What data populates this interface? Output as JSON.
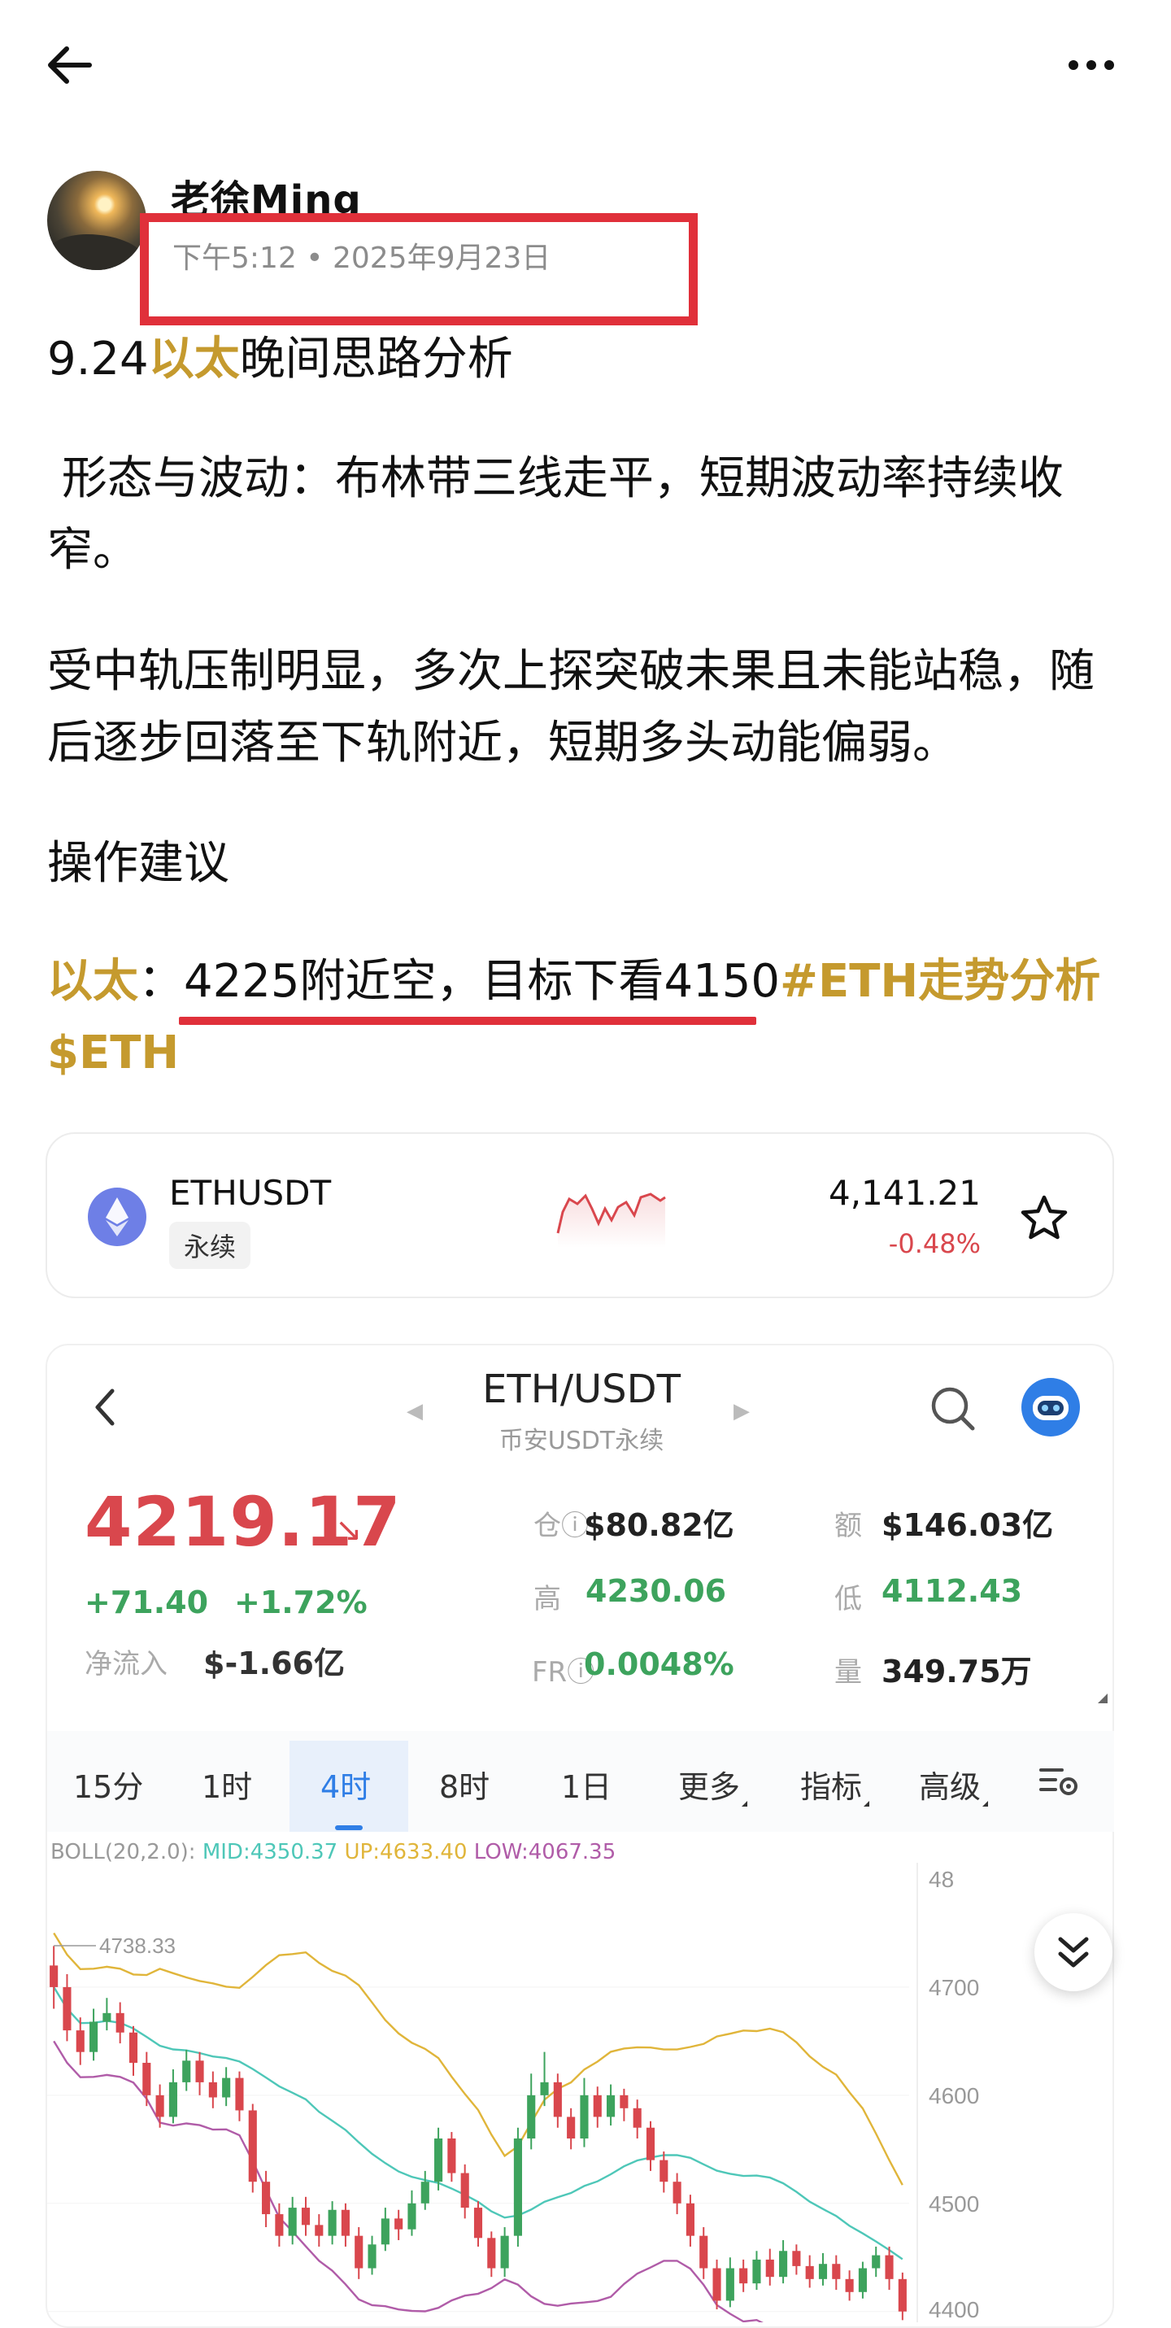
{
  "header": {
    "back_icon": "arrow-left-icon",
    "more_icon": "more-horizontal-icon"
  },
  "author": {
    "name": "老徐Ming",
    "time": "下午5:12 • 2025年9月23日"
  },
  "post": {
    "headline_pre": "9.24",
    "headline_gold": "以太",
    "headline_post": "晚间思路分析",
    "p1": " 形态与波动：布林带三线走平，短期波动率持续收窄。",
    "p2": "受中轨压制明显，多次上探突破未果且未能站稳，随后逐步回落至下轨附近，短期多头动能偏弱。",
    "p3": "操作建议",
    "p4_gold": "以太",
    "p4_colon": "：",
    "p4_text": "4225附近空，目标下看4150",
    "p4_tag": "#ETH走势分析",
    "p4_cashtag": "$ETH"
  },
  "ticker_card": {
    "symbol": "ETHUSDT",
    "badge": "永续",
    "price": "4,141.21",
    "change": "-0.48%",
    "change_color": "#d9474d",
    "icon": "ethereum-icon",
    "star_icon": "star-icon"
  },
  "chart_panel": {
    "pair": "ETH/USDT",
    "subtitle": "币安USDT永续",
    "price": "4219.17",
    "arrow": "↘",
    "change_abs": "+71.40",
    "change_pct": "+1.72%",
    "net_inflow_label": "净流入",
    "net_inflow_value": "$-1.66亿",
    "stats": {
      "oi_label": "仓",
      "oi_value": "$80.82亿",
      "high_label": "高",
      "high_value": "4230.06",
      "fr_label": "FR",
      "fr_value": "0.0048%",
      "amount_label": "额",
      "amount_value": "$146.03亿",
      "low_label": "低",
      "low_value": "4112.43",
      "volume_label": "量",
      "volume_value": "349.75万"
    },
    "tabs": [
      "15分",
      "1时",
      "4时",
      "8时",
      "1日",
      "更多",
      "指标",
      "高级"
    ],
    "active_tab": "4时",
    "boll": {
      "label": "BOLL(20,2.0):",
      "mid": "MID:4350.37",
      "up": "UP:4633.40",
      "low": "LOW:4067.35"
    },
    "max_label": "4738.33",
    "axis_labels": [
      "48",
      "4700",
      "4600",
      "4500",
      "4400"
    ],
    "up_color": "#3da35d",
    "down_color": "#d9474d"
  },
  "chart_data": {
    "type": "candlestick",
    "y_ticks": [
      4700,
      4600,
      4500,
      4400
    ],
    "ylim": [
      4390,
      4800
    ],
    "max_marker": 4738.33,
    "candles": [
      [
        4720,
        4700,
        4738,
        4680
      ],
      [
        4700,
        4660,
        4712,
        4650
      ],
      [
        4660,
        4640,
        4672,
        4628
      ],
      [
        4640,
        4668,
        4680,
        4632
      ],
      [
        4668,
        4676,
        4690,
        4660
      ],
      [
        4676,
        4658,
        4686,
        4648
      ],
      [
        4658,
        4630,
        4664,
        4618
      ],
      [
        4630,
        4600,
        4640,
        4590
      ],
      [
        4600,
        4580,
        4610,
        4570
      ],
      [
        4580,
        4612,
        4624,
        4574
      ],
      [
        4612,
        4632,
        4642,
        4604
      ],
      [
        4632,
        4612,
        4640,
        4600
      ],
      [
        4612,
        4598,
        4622,
        4588
      ],
      [
        4598,
        4616,
        4626,
        4590
      ],
      [
        4616,
        4586,
        4622,
        4576
      ],
      [
        4586,
        4520,
        4592,
        4510
      ],
      [
        4520,
        4490,
        4530,
        4478
      ],
      [
        4490,
        4470,
        4500,
        4460
      ],
      [
        4470,
        4496,
        4506,
        4462
      ],
      [
        4496,
        4480,
        4506,
        4470
      ],
      [
        4480,
        4470,
        4490,
        4460
      ],
      [
        4470,
        4494,
        4502,
        4462
      ],
      [
        4494,
        4470,
        4500,
        4460
      ],
      [
        4470,
        4440,
        4478,
        4430
      ],
      [
        4440,
        4462,
        4470,
        4434
      ],
      [
        4462,
        4486,
        4496,
        4456
      ],
      [
        4486,
        4476,
        4494,
        4466
      ],
      [
        4476,
        4500,
        4512,
        4470
      ],
      [
        4500,
        4520,
        4530,
        4494
      ],
      [
        4520,
        4560,
        4570,
        4512
      ],
      [
        4560,
        4528,
        4566,
        4520
      ],
      [
        4528,
        4496,
        4536,
        4486
      ],
      [
        4496,
        4468,
        4502,
        4460
      ],
      [
        4468,
        4440,
        4474,
        4432
      ],
      [
        4440,
        4470,
        4478,
        4432
      ],
      [
        4470,
        4560,
        4570,
        4460
      ],
      [
        4560,
        4600,
        4620,
        4550
      ],
      [
        4600,
        4612,
        4640,
        4590
      ],
      [
        4612,
        4580,
        4620,
        4570
      ],
      [
        4580,
        4560,
        4588,
        4550
      ],
      [
        4560,
        4600,
        4616,
        4552
      ],
      [
        4600,
        4580,
        4608,
        4570
      ],
      [
        4580,
        4600,
        4610,
        4572
      ],
      [
        4600,
        4588,
        4606,
        4576
      ],
      [
        4588,
        4570,
        4596,
        4560
      ],
      [
        4570,
        4540,
        4576,
        4530
      ],
      [
        4540,
        4520,
        4548,
        4510
      ],
      [
        4520,
        4500,
        4528,
        4490
      ],
      [
        4500,
        4470,
        4508,
        4460
      ],
      [
        4470,
        4440,
        4478,
        4430
      ],
      [
        4440,
        4410,
        4448,
        4402
      ],
      [
        4410,
        4440,
        4450,
        4404
      ],
      [
        4440,
        4426,
        4448,
        4418
      ],
      [
        4426,
        4448,
        4456,
        4420
      ],
      [
        4448,
        4432,
        4458,
        4424
      ],
      [
        4432,
        4456,
        4466,
        4426
      ],
      [
        4456,
        4442,
        4462,
        4434
      ],
      [
        4442,
        4430,
        4452,
        4422
      ],
      [
        4430,
        4444,
        4454,
        4424
      ],
      [
        4444,
        4430,
        4452,
        4420
      ],
      [
        4430,
        4418,
        4438,
        4410
      ],
      [
        4418,
        4440,
        4446,
        4412
      ],
      [
        4440,
        4452,
        4460,
        4432
      ],
      [
        4452,
        4430,
        4460,
        4420
      ],
      [
        4430,
        4400,
        4436,
        4392
      ]
    ]
  }
}
